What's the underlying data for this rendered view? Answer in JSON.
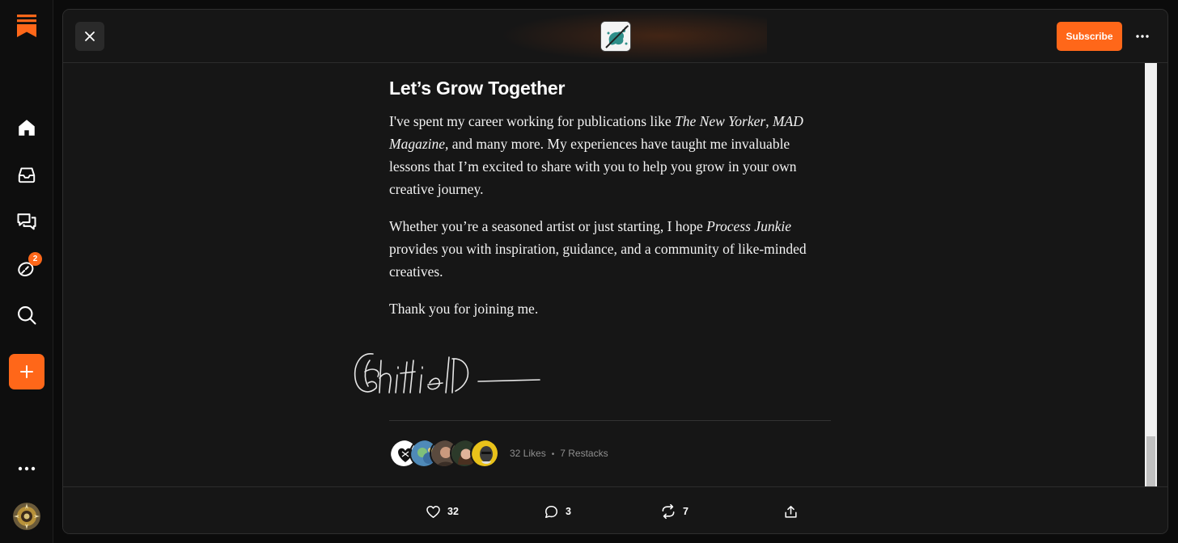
{
  "sidebar": {
    "items": [
      {
        "name": "home"
      },
      {
        "name": "inbox"
      },
      {
        "name": "chat"
      },
      {
        "name": "activity",
        "badge": "2"
      },
      {
        "name": "search"
      }
    ],
    "create_label": "+"
  },
  "topbar": {
    "subscribe_label": "Subscribe"
  },
  "article": {
    "heading": "Let’s Grow Together",
    "p1_a": "I've spent my career working for publications like ",
    "p1_em1": "The New Yorker",
    "p1_b": ", ",
    "p1_em2": "MAD Magazine",
    "p1_c": ", and many more. My experiences have taught me invaluable lessons that I’m excited to share with you to help you grow in your own creative journey.",
    "p2_a": "Whether you’re a seasoned artist or just starting, I hope ",
    "p2_em": "Process Junkie",
    "p2_b": " provides you with inspiration, guidance, and a community of like-minded creatives.",
    "p3": "Thank you for joining me."
  },
  "engagement": {
    "likes_text": "32 Likes",
    "separator": "•",
    "restacks_text": "7 Restacks"
  },
  "actions": {
    "like_count": "32",
    "comment_count": "3",
    "restack_count": "7"
  },
  "colors": {
    "accent": "#ff6719",
    "background": "#161616"
  }
}
